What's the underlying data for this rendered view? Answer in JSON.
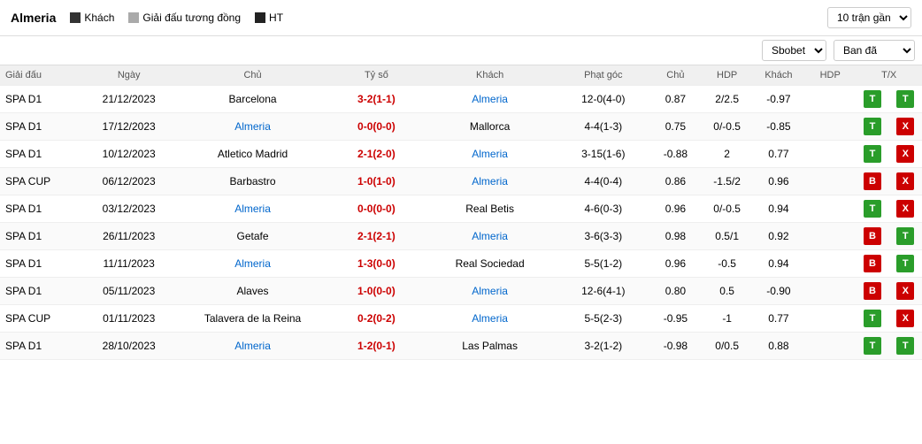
{
  "header": {
    "team": "Almeria",
    "legends": [
      {
        "id": "khach",
        "label": "Khách",
        "color": "#333"
      },
      {
        "id": "giai-dau-tuong-dong",
        "label": "Giải đấu tương đồng",
        "color": "#aaa"
      },
      {
        "id": "ht",
        "label": "HT",
        "color": "#222"
      }
    ],
    "dropdown_matches": "10 trận gần",
    "dropdown_sbobet": "Sbobet",
    "dropdown_ban_da": "Ban đã"
  },
  "columns": {
    "giai_dau": "Giải đấu",
    "ngay": "Ngày",
    "chu": "Chủ",
    "ty_so": "Tỷ số",
    "khach": "Khách",
    "phat_goc": "Phạt góc",
    "chu2": "Chủ",
    "hdp1": "HDP",
    "khach2": "Khách",
    "hdp2": "HDP",
    "tx": "T/X"
  },
  "rows": [
    {
      "giai": "SPA D1",
      "ngay": "21/12/2023",
      "chu": "Barcelona",
      "chu_link": false,
      "ty_so": "3-2(1-1)",
      "khach": "Almeria",
      "khach_link": true,
      "phat_goc": "12-0(4-0)",
      "col_chu": "0.87",
      "hdp1": "2/2.5",
      "col_khach": "-0.97",
      "hdp2": "",
      "t": "T",
      "t_type": "t",
      "x": "T",
      "x_type": "t"
    },
    {
      "giai": "SPA D1",
      "ngay": "17/12/2023",
      "chu": "Almeria",
      "chu_link": true,
      "ty_so": "0-0(0-0)",
      "khach": "Mallorca",
      "khach_link": false,
      "phat_goc": "4-4(1-3)",
      "col_chu": "0.75",
      "hdp1": "0/-0.5",
      "col_khach": "-0.85",
      "hdp2": "",
      "t": "T",
      "t_type": "t",
      "x": "X",
      "x_type": "x"
    },
    {
      "giai": "SPA D1",
      "ngay": "10/12/2023",
      "chu": "Atletico Madrid",
      "chu_link": false,
      "ty_so": "2-1(2-0)",
      "khach": "Almeria",
      "khach_link": true,
      "phat_goc": "3-15(1-6)",
      "col_chu": "-0.88",
      "hdp1": "2",
      "col_khach": "0.77",
      "hdp2": "",
      "t": "T",
      "t_type": "t",
      "x": "X",
      "x_type": "x"
    },
    {
      "giai": "SPA CUP",
      "ngay": "06/12/2023",
      "chu": "Barbastro",
      "chu_link": false,
      "ty_so": "1-0(1-0)",
      "khach": "Almeria",
      "khach_link": true,
      "phat_goc": "4-4(0-4)",
      "col_chu": "0.86",
      "hdp1": "-1.5/2",
      "col_khach": "0.96",
      "hdp2": "",
      "t": "B",
      "t_type": "b",
      "x": "X",
      "x_type": "x"
    },
    {
      "giai": "SPA D1",
      "ngay": "03/12/2023",
      "chu": "Almeria",
      "chu_link": true,
      "ty_so": "0-0(0-0)",
      "khach": "Real Betis",
      "khach_link": false,
      "phat_goc": "4-6(0-3)",
      "col_chu": "0.96",
      "hdp1": "0/-0.5",
      "col_khach": "0.94",
      "hdp2": "",
      "t": "T",
      "t_type": "t",
      "x": "X",
      "x_type": "x"
    },
    {
      "giai": "SPA D1",
      "ngay": "26/11/2023",
      "chu": "Getafe",
      "chu_link": false,
      "ty_so": "2-1(2-1)",
      "khach": "Almeria",
      "khach_link": true,
      "phat_goc": "3-6(3-3)",
      "col_chu": "0.98",
      "hdp1": "0.5/1",
      "col_khach": "0.92",
      "hdp2": "",
      "t": "B",
      "t_type": "b",
      "x": "T",
      "x_type": "t"
    },
    {
      "giai": "SPA D1",
      "ngay": "11/11/2023",
      "chu": "Almeria",
      "chu_link": true,
      "ty_so": "1-3(0-0)",
      "khach": "Real Sociedad",
      "khach_link": false,
      "phat_goc": "5-5(1-2)",
      "col_chu": "0.96",
      "hdp1": "-0.5",
      "col_khach": "0.94",
      "hdp2": "",
      "t": "B",
      "t_type": "b",
      "x": "T",
      "x_type": "t"
    },
    {
      "giai": "SPA D1",
      "ngay": "05/11/2023",
      "chu": "Alaves",
      "chu_link": false,
      "ty_so": "1-0(0-0)",
      "khach": "Almeria",
      "khach_link": true,
      "phat_goc": "12-6(4-1)",
      "col_chu": "0.80",
      "hdp1": "0.5",
      "col_khach": "-0.90",
      "hdp2": "",
      "t": "B",
      "t_type": "b",
      "x": "X",
      "x_type": "x"
    },
    {
      "giai": "SPA CUP",
      "ngay": "01/11/2023",
      "chu": "Talavera de la Reina",
      "chu_link": false,
      "ty_so": "0-2(0-2)",
      "khach": "Almeria",
      "khach_link": true,
      "phat_goc": "5-5(2-3)",
      "col_chu": "-0.95",
      "hdp1": "-1",
      "col_khach": "0.77",
      "hdp2": "",
      "t": "T",
      "t_type": "t",
      "x": "X",
      "x_type": "x"
    },
    {
      "giai": "SPA D1",
      "ngay": "28/10/2023",
      "chu": "Almeria",
      "chu_link": true,
      "ty_so": "1-2(0-1)",
      "khach": "Las Palmas",
      "khach_link": false,
      "phat_goc": "3-2(1-2)",
      "col_chu": "-0.98",
      "hdp1": "0/0.5",
      "col_khach": "0.88",
      "hdp2": "",
      "t": "T",
      "t_type": "t",
      "x": "T",
      "x_type": "t"
    }
  ]
}
